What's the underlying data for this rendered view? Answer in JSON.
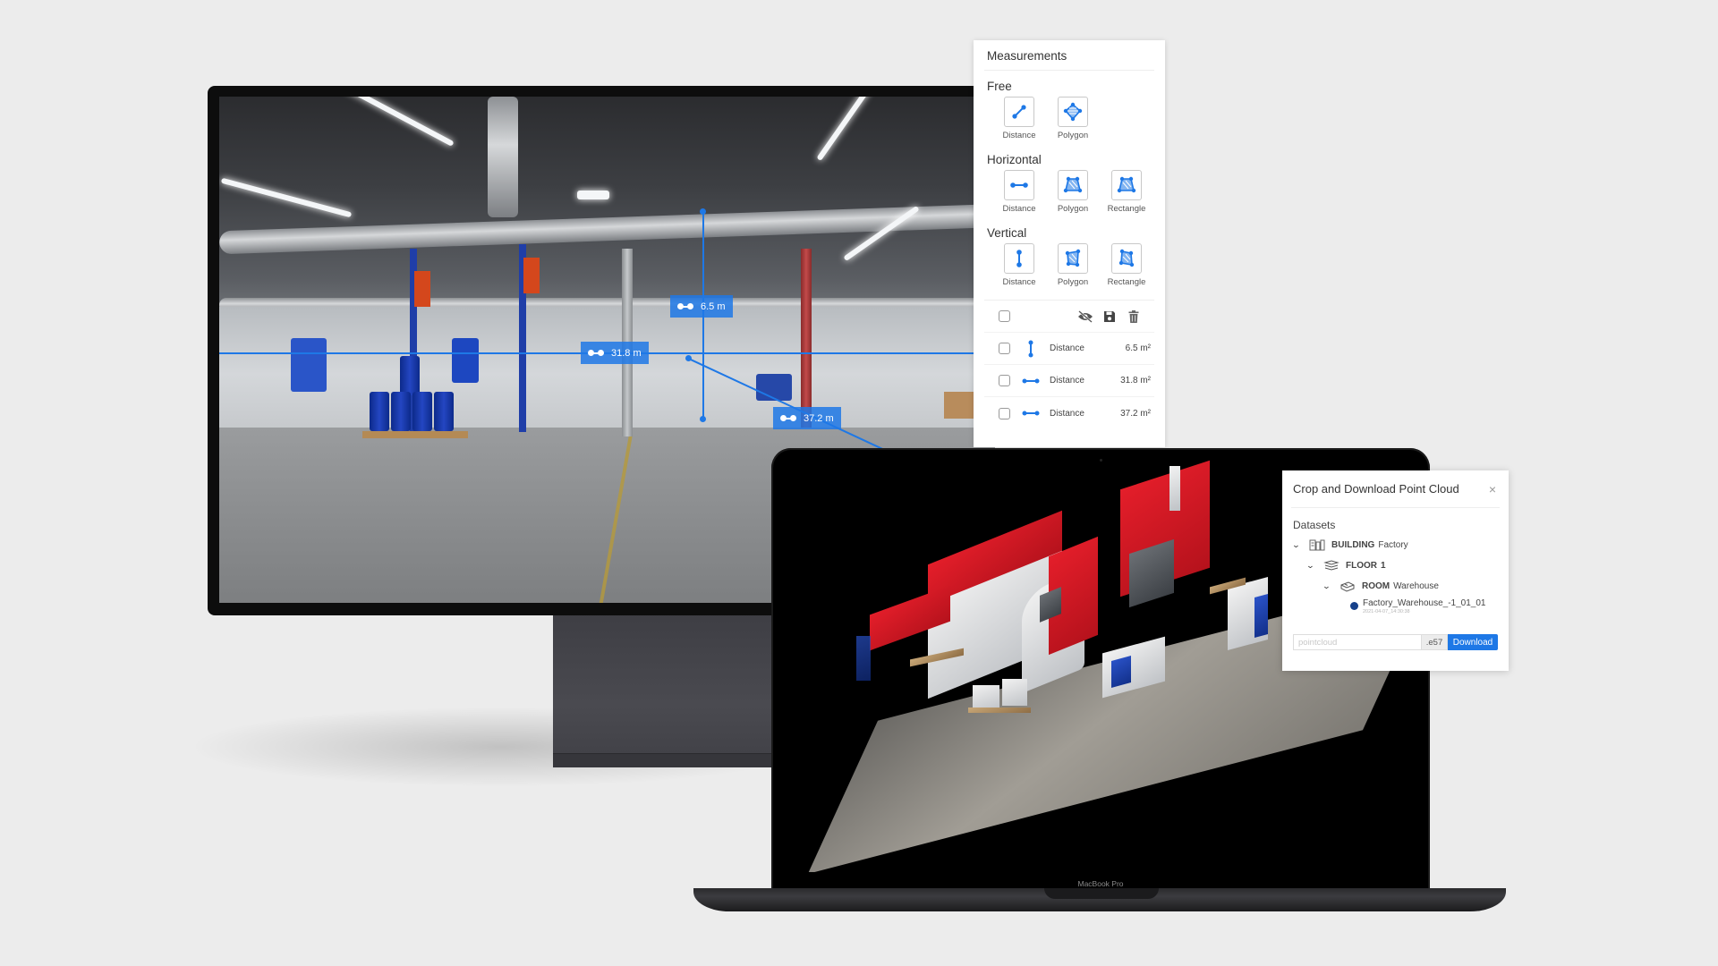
{
  "colors": {
    "accent": "#1e78e6",
    "background": "#ececec",
    "dataset_dot": "#16408a"
  },
  "viewer_360": {
    "measurement_labels": [
      {
        "id": "vertical",
        "value": "6.5 m"
      },
      {
        "id": "horizontal",
        "value": "31.8 m"
      },
      {
        "id": "diagonal",
        "value": "37.2 m"
      }
    ]
  },
  "measurements_panel": {
    "title": "Measurements",
    "sections": [
      {
        "title": "Free",
        "tools": [
          {
            "label": "Distance",
            "icon": "free-distance-icon"
          },
          {
            "label": "Polygon",
            "icon": "free-polygon-icon"
          }
        ]
      },
      {
        "title": "Horizontal",
        "tools": [
          {
            "label": "Distance",
            "icon": "horizontal-distance-icon"
          },
          {
            "label": "Polygon",
            "icon": "horizontal-polygon-icon"
          },
          {
            "label": "Rectangle",
            "icon": "horizontal-rectangle-icon"
          }
        ]
      },
      {
        "title": "Vertical",
        "tools": [
          {
            "label": "Distance",
            "icon": "vertical-distance-icon"
          },
          {
            "label": "Polygon",
            "icon": "vertical-polygon-icon"
          },
          {
            "label": "Rectangle",
            "icon": "vertical-rectangle-icon"
          }
        ]
      }
    ],
    "toolbar": {
      "icons": [
        "hide-icon",
        "save-icon",
        "delete-icon"
      ]
    },
    "items": [
      {
        "type": "Distance",
        "orientation": "vertical",
        "value": "6.5 m²",
        "checked": false
      },
      {
        "type": "Distance",
        "orientation": "horizontal",
        "value": "31.8 m²",
        "checked": false
      },
      {
        "type": "Distance",
        "orientation": "horizontal",
        "value": "37.2 m²",
        "checked": false
      }
    ]
  },
  "laptop": {
    "brand_label": "MacBook Pro"
  },
  "crop_panel": {
    "title": "Crop and Download Point Cloud",
    "close_icon": "×",
    "datasets_label": "Datasets",
    "tree": [
      {
        "level": 0,
        "kind": "BUILDING",
        "name": "Factory",
        "expanded": true,
        "icon": "building-icon"
      },
      {
        "level": 1,
        "kind": "FLOOR",
        "name": "1",
        "expanded": true,
        "icon": "layers-icon"
      },
      {
        "level": 2,
        "kind": "ROOM",
        "name": "Warehouse",
        "expanded": true,
        "icon": "room-icon"
      }
    ],
    "file": {
      "name": "Factory_Warehouse_-1_01_01",
      "timestamp": "2021-04-07_14:30:38"
    },
    "filename_input": {
      "value": "",
      "placeholder": "pointcloud"
    },
    "extension": ".e57",
    "download_label": "Download"
  }
}
